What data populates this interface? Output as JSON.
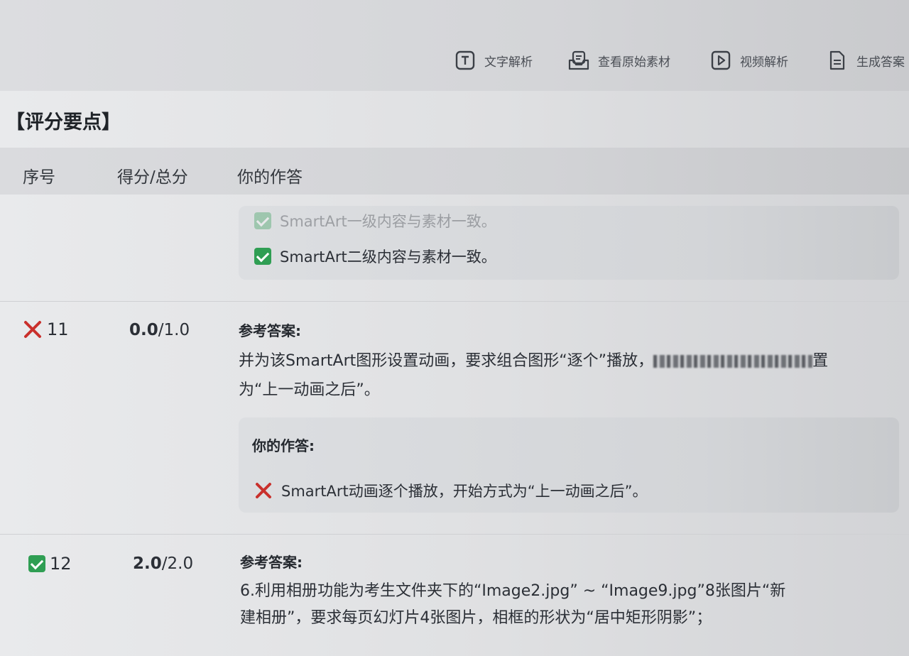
{
  "toolbar": {
    "text_analysis": "文字解析",
    "view_material": "查看原始素材",
    "video_analysis": "视频解析",
    "generate_answer": "生成答案"
  },
  "section_title": "【评分要点】",
  "table_header": {
    "index": "序号",
    "score_total": "得分/总分",
    "your_answer": "你的作答"
  },
  "prev_row": {
    "items": [
      {
        "status": "correct",
        "text": "SmartArt一级内容与素材一致。"
      },
      {
        "status": "correct",
        "text": "SmartArt二级内容与素材一致。"
      }
    ]
  },
  "rows": [
    {
      "number": "11",
      "status": "wrong",
      "score": "0.0",
      "total": "/1.0",
      "ref_label": "参考答案:",
      "ref_line1": "并为该SmartArt图形设置动画，要求组合图形“逐个”播放，",
      "ref_line1_tail": "置",
      "ref_line2": "为“上一动画之后”。",
      "your_label": "你的作答:",
      "your_items": [
        {
          "status": "wrong",
          "text": "SmartArt动画逐个播放，开始方式为“上一动画之后”。"
        }
      ]
    },
    {
      "number": "12",
      "status": "correct",
      "score": "2.0",
      "total": "/2.0",
      "ref_label": "参考答案:",
      "ref_line1": "6.利用相册功能为考生文件夹下的“Image2.jpg” ~ “Image9.jpg”8张图片“新",
      "ref_line2": "建相册”，要求每页幻灯片4张图片，相框的形状为“居中矩形阴影”；"
    }
  ],
  "colors": {
    "correct": "#2f9e53",
    "wrong": "#c9302c"
  }
}
